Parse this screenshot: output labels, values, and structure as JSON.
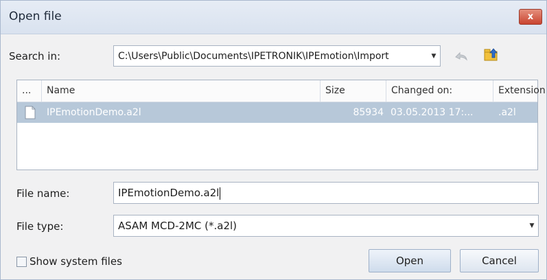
{
  "window": {
    "title": "Open file",
    "close_label": "x"
  },
  "search": {
    "label": "Search in:",
    "path": "C:\\Users\\Public\\Documents\\IPETRONIK\\IPEmotion\\Import"
  },
  "toolbar": {
    "back_icon": "back-arrow-icon",
    "up_icon": "folder-up-icon"
  },
  "file_list": {
    "columns": [
      "...",
      "Name",
      "Size",
      "Changed on:",
      "Extension"
    ],
    "rows": [
      {
        "name": "IPEmotionDemo.a2l",
        "size": "85934",
        "changed": "03.05.2013 17:...",
        "ext": ".a2l",
        "selected": true
      }
    ]
  },
  "file_name": {
    "label": "File name:",
    "value": "IPEmotionDemo.a2l"
  },
  "file_type": {
    "label": "File type:",
    "value": "ASAM MCD-2MC (*.a2l)"
  },
  "show_system": {
    "label": "Show system files",
    "checked": false
  },
  "buttons": {
    "open": "Open",
    "cancel": "Cancel"
  },
  "colors": {
    "selection": "#b7c8d9",
    "title_bg": "#dfe6f1",
    "close_bg": "#c94430"
  }
}
